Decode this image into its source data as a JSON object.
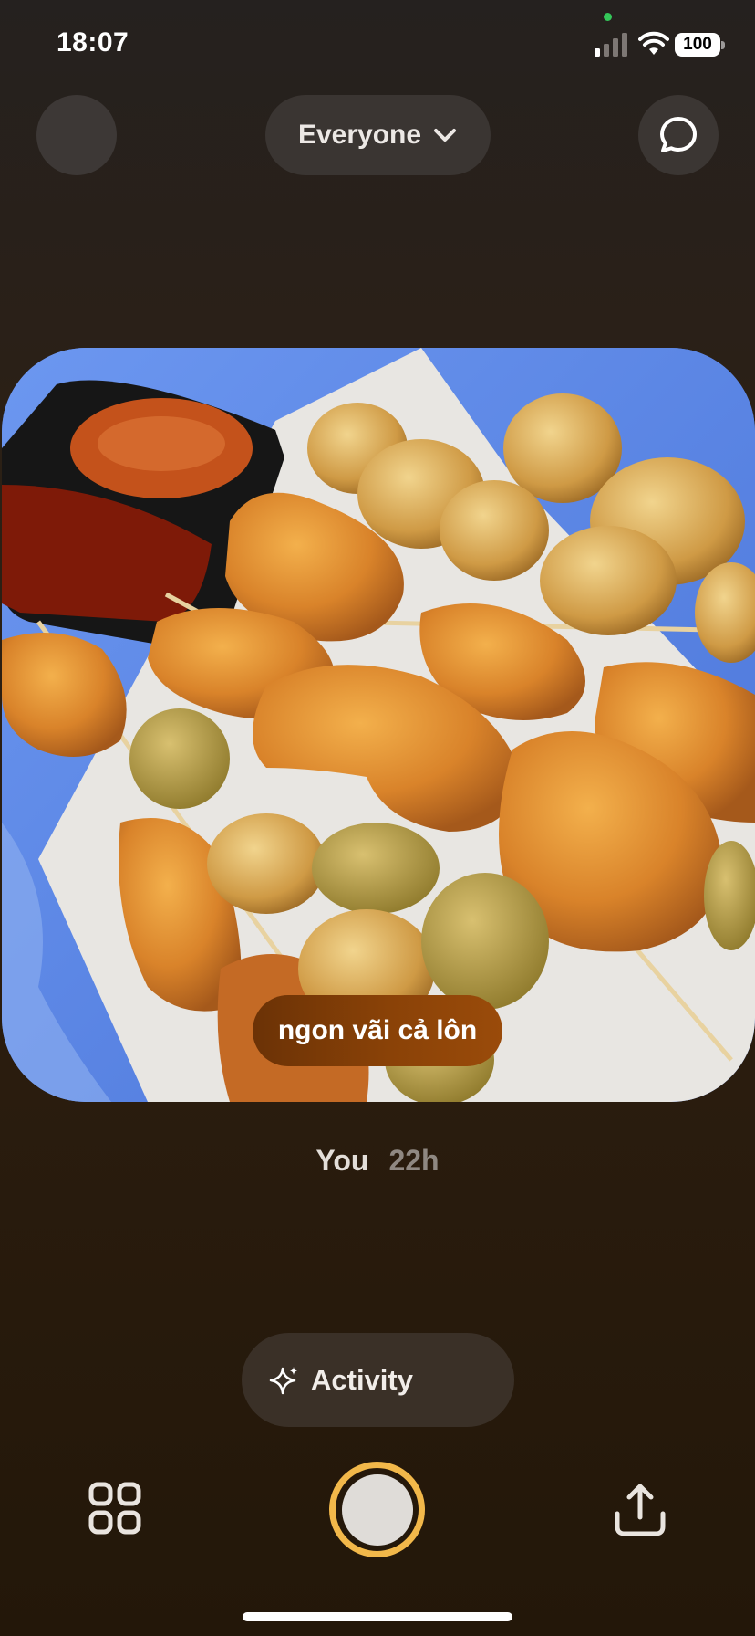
{
  "status_bar": {
    "time": "18:07",
    "battery": "100"
  },
  "top_bar": {
    "audience_label": "Everyone"
  },
  "post": {
    "caption": "ngon vãi cả lôn",
    "author": "You",
    "age": "22h"
  },
  "activity": {
    "label": "Activity"
  },
  "colors": {
    "shutter_ring": "#f2b84a",
    "caption_pill": "#8a4207",
    "background": "#2b1d0f"
  },
  "icons": {
    "chat": "chat-bubble-icon",
    "chevron": "chevron-down-icon",
    "activity": "sparkles-icon",
    "grid": "grid-icon",
    "share": "share-icon"
  }
}
